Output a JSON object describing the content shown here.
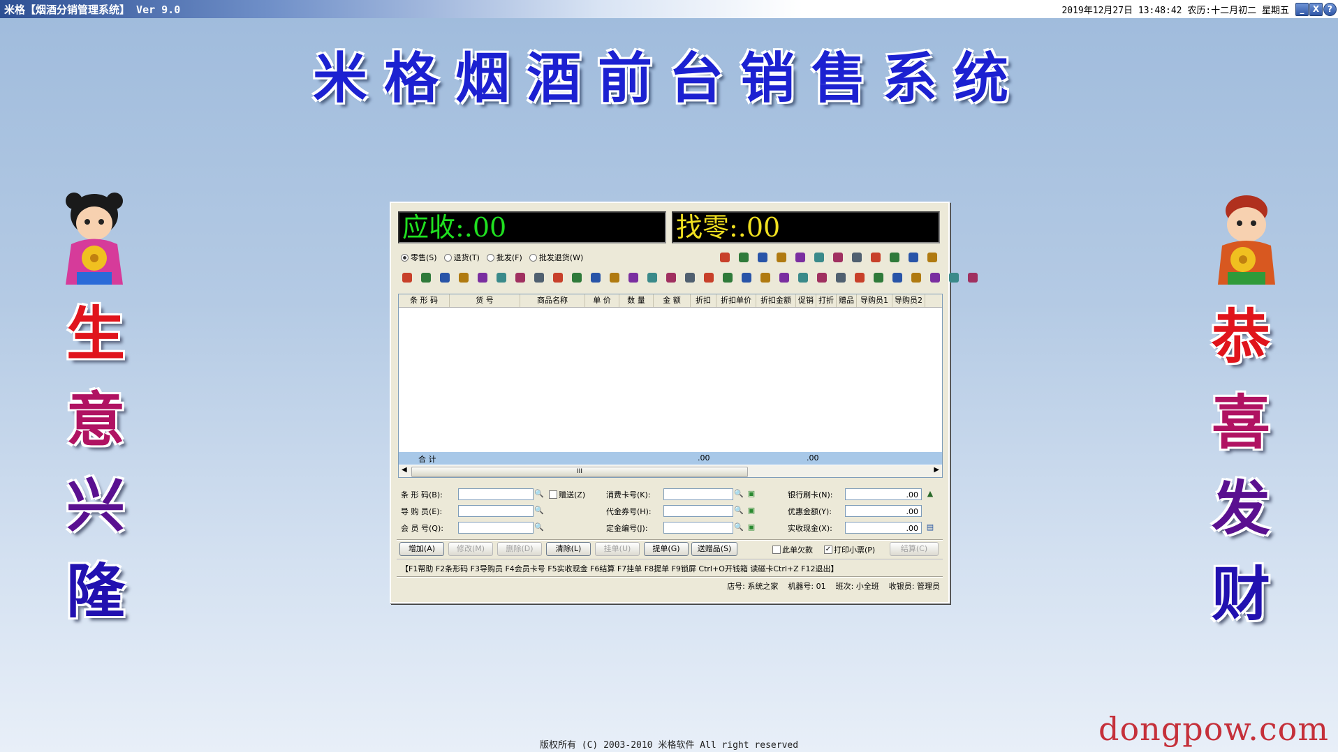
{
  "titlebar": {
    "app_title": "米格【烟酒分销管理系统】 Ver 9.0",
    "clock": "2019年12月27日 13:48:42 农历:十二月初二 星期五",
    "minimize": "_",
    "close": "X",
    "help": "?"
  },
  "banner": "米格烟酒前台销售系统",
  "left_slogan": [
    "生",
    "意",
    "兴",
    "隆"
  ],
  "right_slogan": [
    "恭",
    "喜",
    "发",
    "财"
  ],
  "colors": {
    "left_slogan": "#e0141c",
    "left_slogan_alt": "#b01262",
    "left_slogan_alt2": "#5a1090",
    "left_slogan_alt3": "#2211b0",
    "banner": "#1c21d1",
    "display_due": "#20e020",
    "display_change": "#f0e020"
  },
  "display": {
    "due": "应收:.00",
    "change": "找零:.00"
  },
  "sale_modes": [
    {
      "label": "零售(S)",
      "selected": true
    },
    {
      "label": "退货(T)",
      "selected": false
    },
    {
      "label": "批发(F)",
      "selected": false
    },
    {
      "label": "批发退货(W)",
      "selected": false
    }
  ],
  "grid": {
    "columns": [
      "条 形 码",
      "货  号",
      "商品名称",
      "单 价",
      "数 量",
      "金 额",
      "折扣",
      "折扣单价",
      "折扣金额",
      "促销",
      "打折",
      "赠品",
      "导购员1",
      "导购员2"
    ],
    "total_label": "合  计",
    "total_amount": ".00",
    "total_discount": ".00",
    "scroll_grip": "III"
  },
  "form": {
    "barcode_label": "条 形 码(B):",
    "guide_label": "导 购 员(E):",
    "member_label": "会 员 号(Q):",
    "gift_label": "赠送(Z)",
    "card_label": "消费卡号(K):",
    "voucher_label": "代金券号(H):",
    "deposit_label": "定金编号(J):",
    "bank_label": "银行刷卡(N):",
    "bank_value": ".00",
    "discount_label": "优惠金额(Y):",
    "discount_value": ".00",
    "cash_label": "实收现金(X):",
    "cash_value": ".00"
  },
  "buttons": {
    "add": "增加(A)",
    "modify": "修改(M)",
    "delete": "删除(D)",
    "clear": "清除(L)",
    "hold": "挂单(U)",
    "fetch": "提单(G)",
    "gift": "送赠品(S)",
    "owe_label": "此单欠款",
    "print_label": "打印小票(P)",
    "settle": "结算(C)"
  },
  "hint": "【F1帮助 F2条形码 F3导购员 F4会员卡号 F5实收现金 F6结算 F7挂单 F8提单 F9锁屏 Ctrl+O开钱箱 读磁卡Ctrl+Z F12退出】",
  "status": {
    "shop": "店号: 系统之家",
    "machine": "机器号: 01",
    "shift": "班次: 小全班",
    "cashier": "收银员: 管理员"
  },
  "copyright": "版权所有 (C) 2003-2010 米格软件 All right reserved",
  "watermark": "dongpow.com",
  "toolbar_icons_top": [
    "calculator-icon",
    "memo-icon",
    "table-icon",
    "money-bag-icon",
    "users-icon",
    "card-icon",
    "tool-icon",
    "people-icon",
    "key-icon",
    "window-icon",
    "printer-icon",
    "edit-icon"
  ],
  "toolbar_icons_bottom": [
    "open-icon",
    "back-icon",
    "save-icon",
    "export-icon",
    "import-icon",
    "doc-icon",
    "gear-icon",
    "list-icon",
    "run-icon",
    "frame-icon",
    "search-doc-icon",
    "next-icon",
    "prev-icon",
    "tools-icon",
    "hand-icon",
    "apple-icon",
    "group-icon",
    "cut-icon",
    "photo-icon",
    "transfer-icon",
    "coins-icon",
    "stamp-icon",
    "find-icon",
    "card-reader-icon",
    "cash-box-icon",
    "counter-icon",
    "up-icon",
    "box-icon",
    "gold-icon",
    "flag-icon",
    "clock-icon"
  ]
}
